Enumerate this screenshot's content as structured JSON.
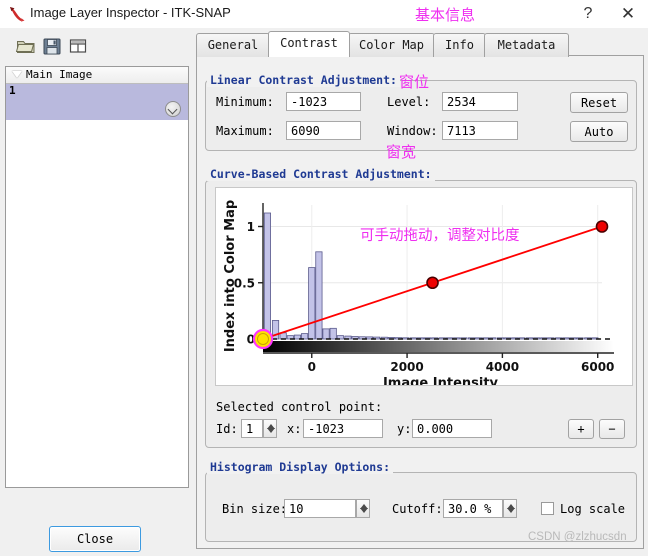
{
  "window": {
    "title": "Image Layer Inspector - ITK-SNAP",
    "app_icon": "itksnap-icon",
    "help_glyph": "?",
    "close_glyph": "✕"
  },
  "toolbar": {
    "items": [
      {
        "name": "open-folder-icon",
        "tip": "Open"
      },
      {
        "name": "save-disk-icon",
        "tip": "Save"
      },
      {
        "name": "table-grid-icon",
        "tip": "Layout"
      }
    ]
  },
  "layer_panel": {
    "header": "Main Image",
    "rows": [
      {
        "number": "1"
      }
    ],
    "chevron_icon": "chevron-down-icon",
    "disclosure_icon": "triangle-down-icon"
  },
  "footer": {
    "close_label": "Close"
  },
  "tabs": {
    "items": [
      {
        "label": "General",
        "active": false
      },
      {
        "label": "Contrast",
        "active": true
      },
      {
        "label": "Color Map",
        "active": false
      },
      {
        "label": "Info",
        "active": false
      },
      {
        "label": "Metadata",
        "active": false
      }
    ]
  },
  "linear_contrast": {
    "title": "Linear Contrast Adjustment:",
    "minimum_label": "Minimum:",
    "minimum_value": "-1023",
    "maximum_label": "Maximum:",
    "maximum_value": "6090",
    "level_label": "Level:",
    "level_value": "2534",
    "window_label": "Window:",
    "window_value": "7113",
    "reset_label": "Reset",
    "auto_label": "Auto"
  },
  "curve_contrast": {
    "title": "Curve-Based Contrast Adjustment:",
    "selected_point_label": "Selected control point:",
    "id_label": "Id:",
    "id_value": "1",
    "x_label": "x:",
    "x_value": "-1023",
    "y_label": "y:",
    "y_value": "0.000",
    "add_label": "+",
    "remove_label": "−"
  },
  "histogram_options": {
    "title": "Histogram Display Options:",
    "bin_size_label": "Bin size:",
    "bin_size_value": "10",
    "cutoff_label": "Cutoff:",
    "cutoff_value": "30.0 %",
    "log_scale_label": "Log scale",
    "log_scale_checked": false
  },
  "annotations": {
    "basic_info": "基本信息",
    "window_level": "窗位",
    "window_width": "窗宽",
    "drag_hint": "可手动拖动，调整对比度",
    "color": "#ef2ef0"
  },
  "watermark": {
    "text": "CSDN @zlzhucsdn"
  },
  "chart_data": {
    "type": "bar",
    "title": "",
    "xlabel": "Image Intensity",
    "ylabel": "Index into Color Map",
    "xlim": [
      -1023,
      6090
    ],
    "ylim": [
      0,
      1.12
    ],
    "xticks": [
      0,
      2000,
      4000,
      6000
    ],
    "yticks": [
      0,
      0.5,
      1
    ],
    "grid": true,
    "legend": "none",
    "bar_color": "#c3c3e8",
    "bar_edge_color": "#5a5a8c",
    "bars": [
      {
        "x": -930,
        "value": 1.12
      },
      {
        "x": -760,
        "value": 0.165
      },
      {
        "x": -600,
        "value": 0.055
      },
      {
        "x": -450,
        "value": 0.03
      },
      {
        "x": -300,
        "value": 0.035
      },
      {
        "x": -150,
        "value": 0.048
      },
      {
        "x": 0,
        "value": 0.635
      },
      {
        "x": 150,
        "value": 0.775
      },
      {
        "x": 300,
        "value": 0.09
      },
      {
        "x": 450,
        "value": 0.095
      },
      {
        "x": 600,
        "value": 0.03
      },
      {
        "x": 760,
        "value": 0.026
      },
      {
        "x": 910,
        "value": 0.022
      },
      {
        "x": 1060,
        "value": 0.02
      },
      {
        "x": 1210,
        "value": 0.019
      },
      {
        "x": 1360,
        "value": 0.017
      },
      {
        "x": 1520,
        "value": 0.016
      },
      {
        "x": 1670,
        "value": 0.014
      },
      {
        "x": 1820,
        "value": 0.012
      },
      {
        "x": 1970,
        "value": 0.011
      },
      {
        "x": 2130,
        "value": 0.01
      },
      {
        "x": 2280,
        "value": 0.009
      },
      {
        "x": 2430,
        "value": 0.008
      },
      {
        "x": 2580,
        "value": 0.008
      },
      {
        "x": 2740,
        "value": 0.007
      },
      {
        "x": 2890,
        "value": 0.007
      },
      {
        "x": 3040,
        "value": 0.006
      },
      {
        "x": 3190,
        "value": 0.006
      },
      {
        "x": 3350,
        "value": 0.006
      },
      {
        "x": 3500,
        "value": 0.005
      },
      {
        "x": 3650,
        "value": 0.005
      },
      {
        "x": 3800,
        "value": 0.005
      },
      {
        "x": 3960,
        "value": 0.005
      },
      {
        "x": 4110,
        "value": 0.004
      },
      {
        "x": 4260,
        "value": 0.004
      },
      {
        "x": 4410,
        "value": 0.004
      },
      {
        "x": 4570,
        "value": 0.004
      },
      {
        "x": 4720,
        "value": 0.004
      },
      {
        "x": 4870,
        "value": 0.004
      },
      {
        "x": 5020,
        "value": 0.003
      },
      {
        "x": 5180,
        "value": 0.003
      },
      {
        "x": 5330,
        "value": 0.003
      },
      {
        "x": 5480,
        "value": 0.003
      },
      {
        "x": 5630,
        "value": 0.003
      },
      {
        "x": 5790,
        "value": 0.003
      },
      {
        "x": 5940,
        "value": 0.003
      }
    ],
    "curve": {
      "name": "intensity-curve",
      "color": "#ff0000",
      "points": [
        {
          "id": 1,
          "x": -1023,
          "y": 0.0,
          "selected": true
        },
        {
          "id": 2,
          "x": 2534,
          "y": 0.5,
          "selected": false
        },
        {
          "id": 3,
          "x": 6090,
          "y": 1.0,
          "selected": false
        }
      ]
    },
    "colorbar": {
      "from": "#000000",
      "to": "#ffffff"
    }
  }
}
